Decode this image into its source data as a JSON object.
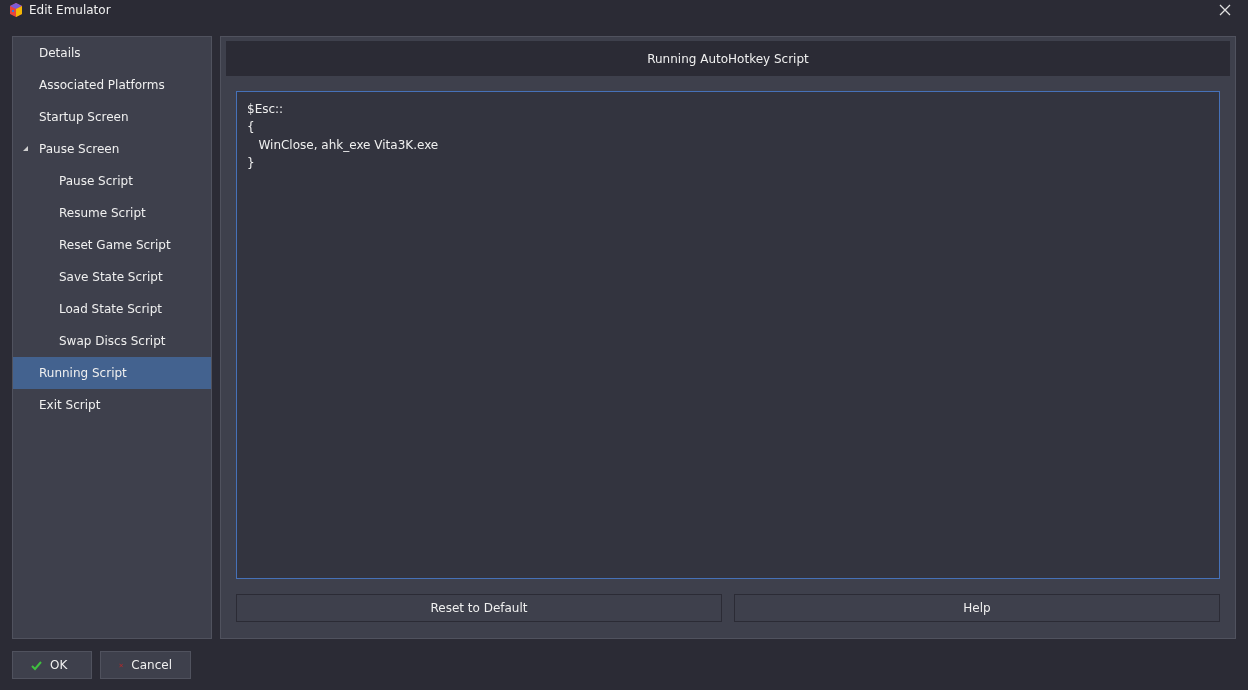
{
  "window": {
    "title": "Edit Emulator"
  },
  "sidebar": {
    "items": [
      {
        "label": "Details",
        "selected": false
      },
      {
        "label": "Associated Platforms",
        "selected": false
      },
      {
        "label": "Startup Screen",
        "selected": false
      },
      {
        "label": "Pause Screen",
        "selected": false,
        "expanded": true,
        "children": [
          {
            "label": "Pause Script",
            "selected": false
          },
          {
            "label": "Resume Script",
            "selected": false
          },
          {
            "label": "Reset Game Script",
            "selected": false
          },
          {
            "label": "Save State Script",
            "selected": false
          },
          {
            "label": "Load State Script",
            "selected": false
          },
          {
            "label": "Swap Discs Script",
            "selected": false
          }
        ]
      },
      {
        "label": "Running Script",
        "selected": true
      },
      {
        "label": "Exit Script",
        "selected": false
      }
    ]
  },
  "panel": {
    "header": "Running AutoHotkey Script",
    "script": "$Esc::\n{\n   WinClose, ahk_exe Vita3K.exe\n}",
    "buttons": [
      "Reset to Default",
      "Help"
    ]
  },
  "footer": {
    "buttons": [
      {
        "label": "OK",
        "kind": "ok"
      },
      {
        "label": "Cancel",
        "kind": "cancel"
      }
    ]
  }
}
